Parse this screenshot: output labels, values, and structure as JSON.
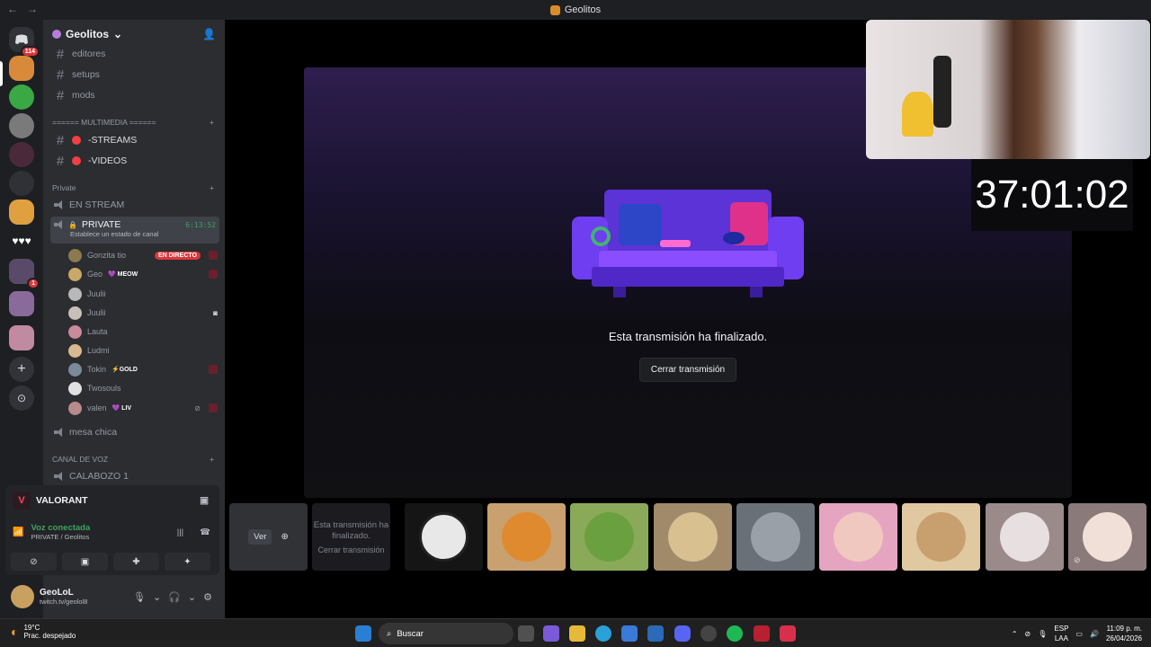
{
  "titlebar": {
    "title": "Geolitos",
    "back": "←",
    "forward": "→"
  },
  "guilds": {
    "home_badge": "114",
    "badge_1": "1"
  },
  "server": {
    "name": "Geolitos"
  },
  "channels": {
    "text": [
      "editores",
      "setups",
      "mods"
    ],
    "multimedia_category": "====== MULTIMEDIA ======",
    "multimedia": [
      "-STREAMS",
      "-VIDEOS"
    ],
    "private_category": "Private",
    "en_stream": "EN STREAM",
    "private_channel": "PRIVATE",
    "private_time": "6:13:52",
    "private_status": "Establece un estado de canal",
    "mesa_chica": "mesa chica",
    "voz_category": "CANAL DE VOZ",
    "calabozo": "CALABOZO 1"
  },
  "voice_users": [
    {
      "name": "Gonzita tio",
      "tag": "",
      "live": "EN DIRECTO",
      "color": "#8a7a4e"
    },
    {
      "name": "Geo",
      "tag": "💜 MEOW",
      "live": "",
      "color": "#c9a86a"
    },
    {
      "name": "Juulii",
      "tag": "",
      "live": "",
      "color": "#b8b8b8"
    },
    {
      "name": "Juulii",
      "tag": "",
      "live": "",
      "color": "#c8c0b8"
    },
    {
      "name": "Lauta",
      "tag": "",
      "live": "",
      "color": "#c98a9a"
    },
    {
      "name": "Ludmi",
      "tag": "",
      "live": "",
      "color": "#d8b890"
    },
    {
      "name": "Tokin",
      "tag": "⚡GOLD",
      "live": "",
      "color": "#7a8a9a"
    },
    {
      "name": "Twosouls",
      "tag": "",
      "live": "",
      "color": "#e0e0e0"
    },
    {
      "name": "valen",
      "tag": "💜 LIV",
      "live": "",
      "color": "#b88a8a"
    }
  ],
  "activity": {
    "game": "VALORANT"
  },
  "voice": {
    "status": "Voz conectada",
    "channel": "PRIVATE / Geolitos"
  },
  "user": {
    "name": "GeoLoL",
    "status": "twitch.tv/geolol8"
  },
  "stream": {
    "ended_text": "Esta transmisión ha finalizado.",
    "close_label": "Cerrar transmisión",
    "timer": "37:01:02"
  },
  "tiles": {
    "ver_label": "Ver",
    "mini_ended": "Esta transmisión ha finalizado.",
    "mini_close": "Cerrar transmisión"
  },
  "taskbar": {
    "temp": "19°C",
    "weather": "Prac. despejado",
    "search": "Buscar",
    "lang1": "ESP",
    "lang2": "LAA",
    "time": "11:09 p. m.",
    "date": "26/04/2026"
  }
}
